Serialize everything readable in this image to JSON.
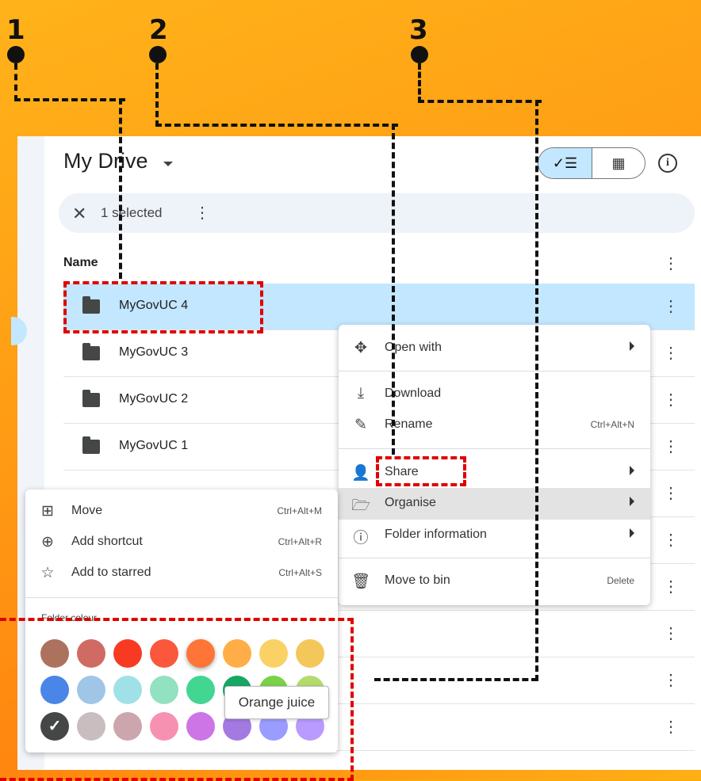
{
  "callouts": [
    "1",
    "2",
    "3"
  ],
  "header": {
    "title": "My Drive",
    "list_view_icon": "check-list-icon",
    "grid_view_icon": "grid-icon",
    "info_icon": "info-icon",
    "info_glyph": "i"
  },
  "selection_bar": {
    "close_glyph": "✕",
    "count_text": "1 selected",
    "more_glyph": "⋮"
  },
  "table": {
    "column_name": "Name",
    "more_glyph": "⋮",
    "rows": [
      {
        "name": "MyGovUC 4",
        "selected": true
      },
      {
        "name": "MyGovUC 3",
        "selected": false
      },
      {
        "name": "MyGovUC 2",
        "selected": false
      },
      {
        "name": "MyGovUC 1",
        "selected": false
      }
    ]
  },
  "context_menu": {
    "items": [
      {
        "label": "Open with",
        "icon": "open-with-icon",
        "submenu": true
      },
      {
        "label": "Download",
        "icon": "download-icon"
      },
      {
        "label": "Rename",
        "icon": "rename-icon",
        "shortcut": "Ctrl+Alt+N"
      },
      {
        "label": "Share",
        "icon": "share-icon",
        "submenu": true
      },
      {
        "label": "Organise",
        "icon": "folder-open-icon",
        "submenu": true,
        "highlighted": true
      },
      {
        "label": "Folder information",
        "icon": "info-icon",
        "submenu": true
      },
      {
        "label": "Move to bin",
        "icon": "bin-icon",
        "shortcut": "Delete"
      }
    ]
  },
  "organise_menu": {
    "items": [
      {
        "label": "Move",
        "icon": "move-icon",
        "shortcut": "Ctrl+Alt+M"
      },
      {
        "label": "Add shortcut",
        "icon": "add-shortcut-icon",
        "shortcut": "Ctrl+Alt+R"
      },
      {
        "label": "Add to starred",
        "icon": "star-icon",
        "shortcut": "Ctrl+Alt+S"
      }
    ],
    "folder_colour_label": "Folder colour",
    "swatches": [
      [
        "#ac725e",
        "#d06b64",
        "#f83a22",
        "#fa573c",
        "#ff7537",
        "#ffad46",
        "#fad165",
        "#f4c75a"
      ],
      [
        "#4986e7",
        "#9fc6e7",
        "#9fe1e7",
        "#92e1c0",
        "#42d692",
        "#16a765",
        "#7bd148",
        "#b3dc6c"
      ],
      [
        "#444746",
        "#cabdbf",
        "#cca6ac",
        "#f691b2",
        "#cd74e6",
        "#a47ae2",
        "#9a9cff",
        "#b99aff"
      ]
    ],
    "selected_swatch_glyph": "✓",
    "tooltip": "Orange juice"
  }
}
